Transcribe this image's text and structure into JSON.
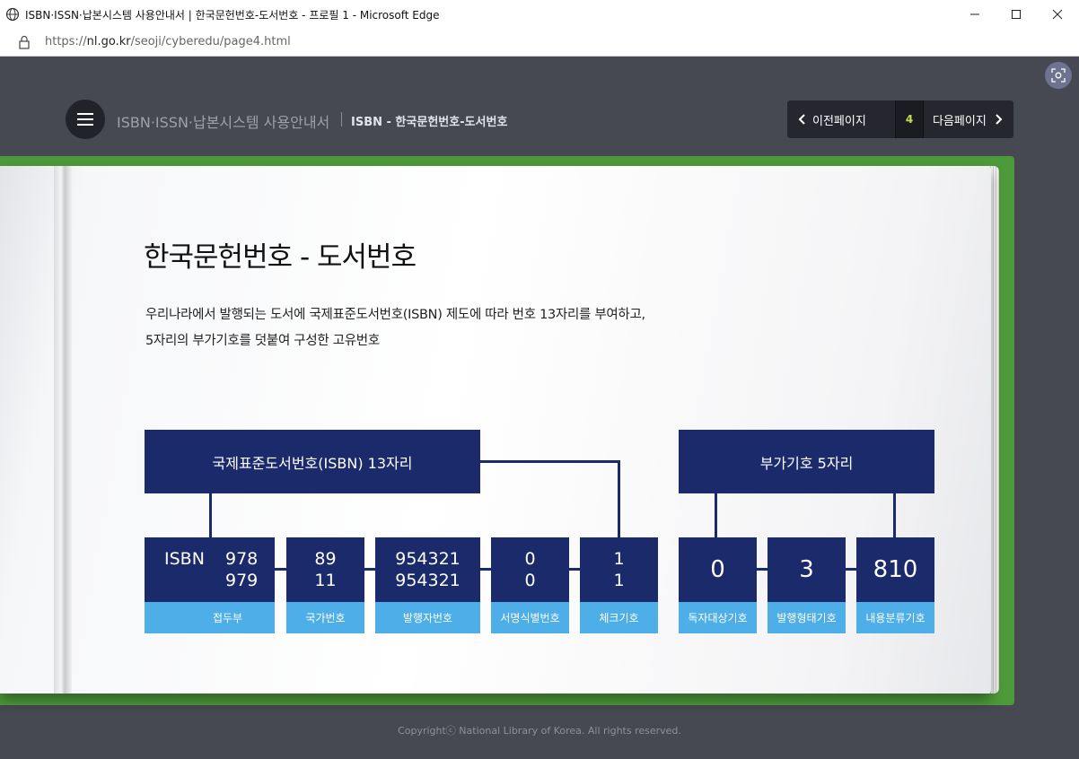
{
  "window": {
    "title": "ISBN·ISSN·납본시스템 사용안내서 | 한국문헌번호-도서번호 - 프로필 1 - Microsoft Edge",
    "minimize": "—",
    "maximize": "☐",
    "close": "✕"
  },
  "address": {
    "domain_prefix": "https://",
    "domain": "nl.go.kr",
    "path": "/seoji/cyberedu/page4.html"
  },
  "header": {
    "site_title": "ISBN·ISSN·납본시스템 사용안내서",
    "page_name": "ISBN - 한국문헌번호-도서번호"
  },
  "nav": {
    "prev_label": "이전페이지",
    "page_number": "4",
    "next_label": "다음페이지"
  },
  "content": {
    "heading": "한국문헌번호 - 도서번호",
    "desc_line1": "우리나라에서 발행되는 도서에 국제표준도서번호(ISBN) 제도에 따라 번호 13자리를 부여하고,",
    "desc_line2": "5자리의 부가기호를 덧붙여 구성한 고유번호"
  },
  "diagram": {
    "isbn_header": "국제표준도서번호(ISBN) 13자리",
    "addon_header": "부가기호 5자리",
    "isbn_prefix": "ISBN",
    "prefix": {
      "v1": "978",
      "v2": "979",
      "label": "접두부"
    },
    "country": {
      "v1": "89",
      "v2": "11",
      "label": "국가번호"
    },
    "publisher": {
      "v1": "954321",
      "v2": "954321",
      "label": "발행자번호"
    },
    "title_id": {
      "v1": "0",
      "v2": "0",
      "label": "서명식별번호"
    },
    "check": {
      "v1": "1",
      "v2": "1",
      "label": "체크기호"
    },
    "reader": {
      "value": "0",
      "label": "독자대상기호"
    },
    "format": {
      "value": "3",
      "label": "발행형태기호"
    },
    "subject": {
      "value": "810",
      "label": "내용분류기호"
    }
  },
  "footer": {
    "copyright": "Copyrightⓒ National Library of Korea. All rights reserved."
  },
  "colors": {
    "navy": "#1b2a6b",
    "label_blue": "#4eaee8",
    "book_green": "#4d9a3a",
    "page_num": "#c7e04a"
  }
}
